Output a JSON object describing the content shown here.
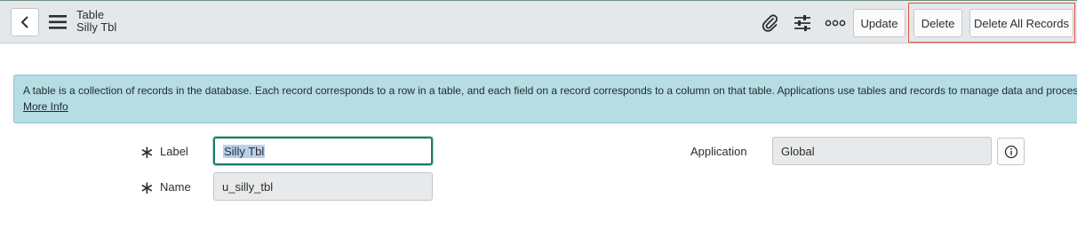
{
  "header": {
    "title": "Table",
    "subtitle": "Silly Tbl",
    "buttons": {
      "update": "Update",
      "delete": "Delete",
      "delete_all": "Delete All Records"
    },
    "icons": [
      "chevron-left-icon",
      "hamburger-menu-icon",
      "paperclip-icon",
      "sliders-icon",
      "more-options-icon"
    ]
  },
  "banner": {
    "message": "A table is a collection of records in the database. Each record corresponds to a row in a table, and each field on a record corresponds to a column on that table. Applications use tables and records to manage data and processes",
    "more_info": "More Info"
  },
  "form": {
    "label": {
      "name": "Label",
      "value": "Silly Tbl",
      "required": true
    },
    "name": {
      "name": "Name",
      "value": "u_silly_tbl",
      "required": true
    },
    "application": {
      "name": "Application",
      "value": "Global"
    }
  },
  "colors": {
    "header_bg": "#e5e8ea",
    "banner_bg": "#b5dde3",
    "focus_border": "#1f7a6a",
    "highlight": "#e0533f"
  }
}
